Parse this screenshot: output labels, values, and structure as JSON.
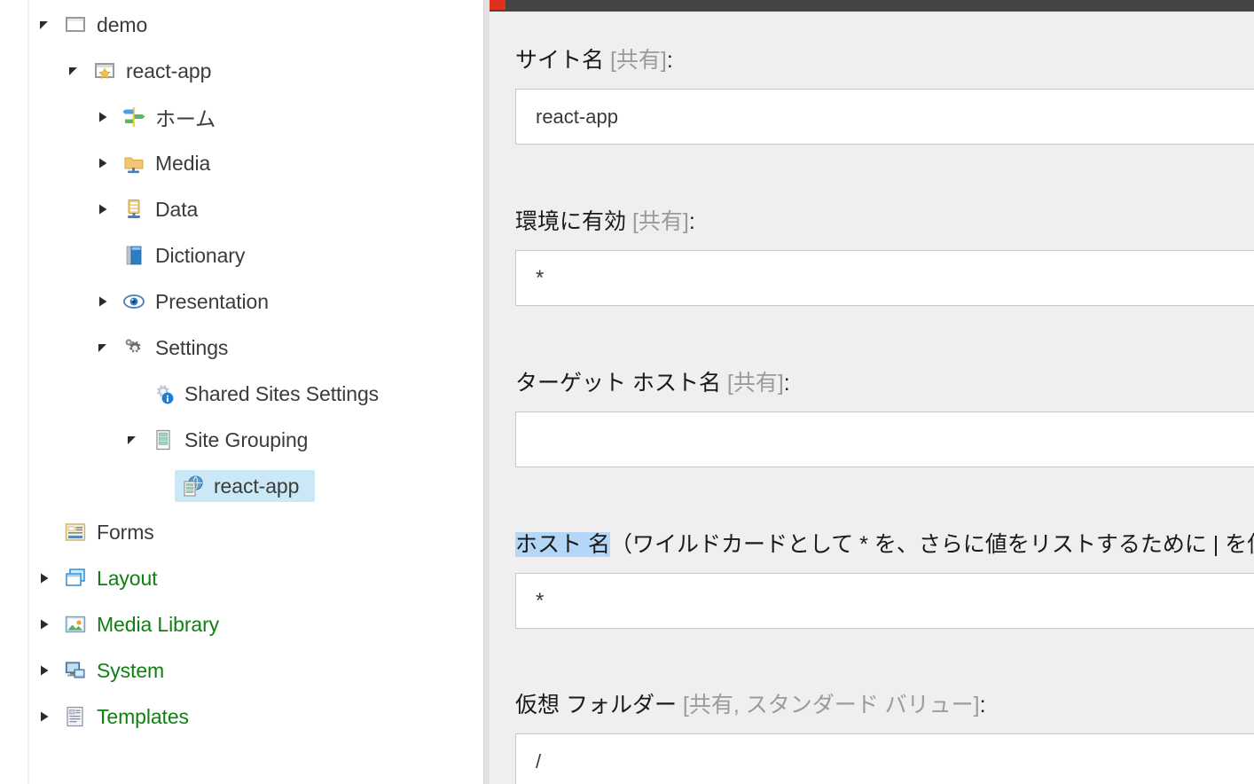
{
  "tree": {
    "items": [
      {
        "label": "demo",
        "icon": "window-icon",
        "indent": 0,
        "twisty": "expanded",
        "selected": false,
        "color": "default"
      },
      {
        "label": "react-app",
        "icon": "site-star-icon",
        "indent": 1,
        "twisty": "expanded",
        "selected": false,
        "color": "default"
      },
      {
        "label": "ホーム",
        "icon": "home-signpost-icon",
        "indent": 2,
        "twisty": "collapsed",
        "selected": false,
        "color": "default"
      },
      {
        "label": "Media",
        "icon": "media-folder-icon",
        "indent": 2,
        "twisty": "collapsed",
        "selected": false,
        "color": "default"
      },
      {
        "label": "Data",
        "icon": "data-rack-icon",
        "indent": 2,
        "twisty": "collapsed",
        "selected": false,
        "color": "default"
      },
      {
        "label": "Dictionary",
        "icon": "dictionary-book-icon",
        "indent": 2,
        "twisty": "none",
        "selected": false,
        "color": "default"
      },
      {
        "label": "Presentation",
        "icon": "eye-icon",
        "indent": 2,
        "twisty": "collapsed",
        "selected": false,
        "color": "default"
      },
      {
        "label": "Settings",
        "icon": "gears-icon",
        "indent": 2,
        "twisty": "expanded",
        "selected": false,
        "color": "default"
      },
      {
        "label": "Shared Sites Settings",
        "icon": "gear-info-icon",
        "indent": 3,
        "twisty": "none",
        "selected": false,
        "color": "default"
      },
      {
        "label": "Site Grouping",
        "icon": "server-list-icon",
        "indent": 3,
        "twisty": "expanded",
        "selected": false,
        "color": "default"
      },
      {
        "label": "react-app",
        "icon": "site-globe-icon",
        "indent": 4,
        "twisty": "none",
        "selected": true,
        "color": "default"
      },
      {
        "label": "Forms",
        "icon": "forms-icon",
        "indent": 0,
        "twisty": "none",
        "selected": false,
        "color": "default"
      },
      {
        "label": "Layout",
        "icon": "layout-windows-icon",
        "indent": 0,
        "twisty": "collapsed",
        "selected": false,
        "color": "green"
      },
      {
        "label": "Media Library",
        "icon": "picture-icon",
        "indent": 0,
        "twisty": "collapsed",
        "selected": false,
        "color": "green"
      },
      {
        "label": "System",
        "icon": "computer-icon",
        "indent": 0,
        "twisty": "collapsed",
        "selected": false,
        "color": "green"
      },
      {
        "label": "Templates",
        "icon": "template-doc-icon",
        "indent": 0,
        "twisty": "collapsed",
        "selected": false,
        "color": "green"
      }
    ]
  },
  "form": {
    "accent_color": "#e0301e",
    "bar_color": "#454545",
    "background_color": "#efefef",
    "highlight_color": "#b5d7f7",
    "fields": [
      {
        "label_main": "サイト名",
        "label_meta": " [共有]",
        "label_suffix": ":",
        "value": "react-app",
        "placeholder": "",
        "highlighted": false
      },
      {
        "label_main": "環境に有効",
        "label_meta": " [共有]",
        "label_suffix": ":",
        "value": "*",
        "placeholder": "",
        "highlighted": false
      },
      {
        "label_main": "ターゲット ホスト名",
        "label_meta": " [共有]",
        "label_suffix": ":",
        "value": "",
        "placeholder": "",
        "highlighted": false
      },
      {
        "label_main": "ホスト 名",
        "label_meta": "",
        "label_suffix": "（ワイルドカードとして * を、さらに値をリストするために | を使用",
        "value": "*",
        "placeholder": "",
        "highlighted": true
      },
      {
        "label_main": "仮想 フォルダー",
        "label_meta": " [共有, スタンダード バリュー]",
        "label_suffix": ":",
        "value": "/",
        "placeholder": "",
        "highlighted": false
      }
    ]
  }
}
